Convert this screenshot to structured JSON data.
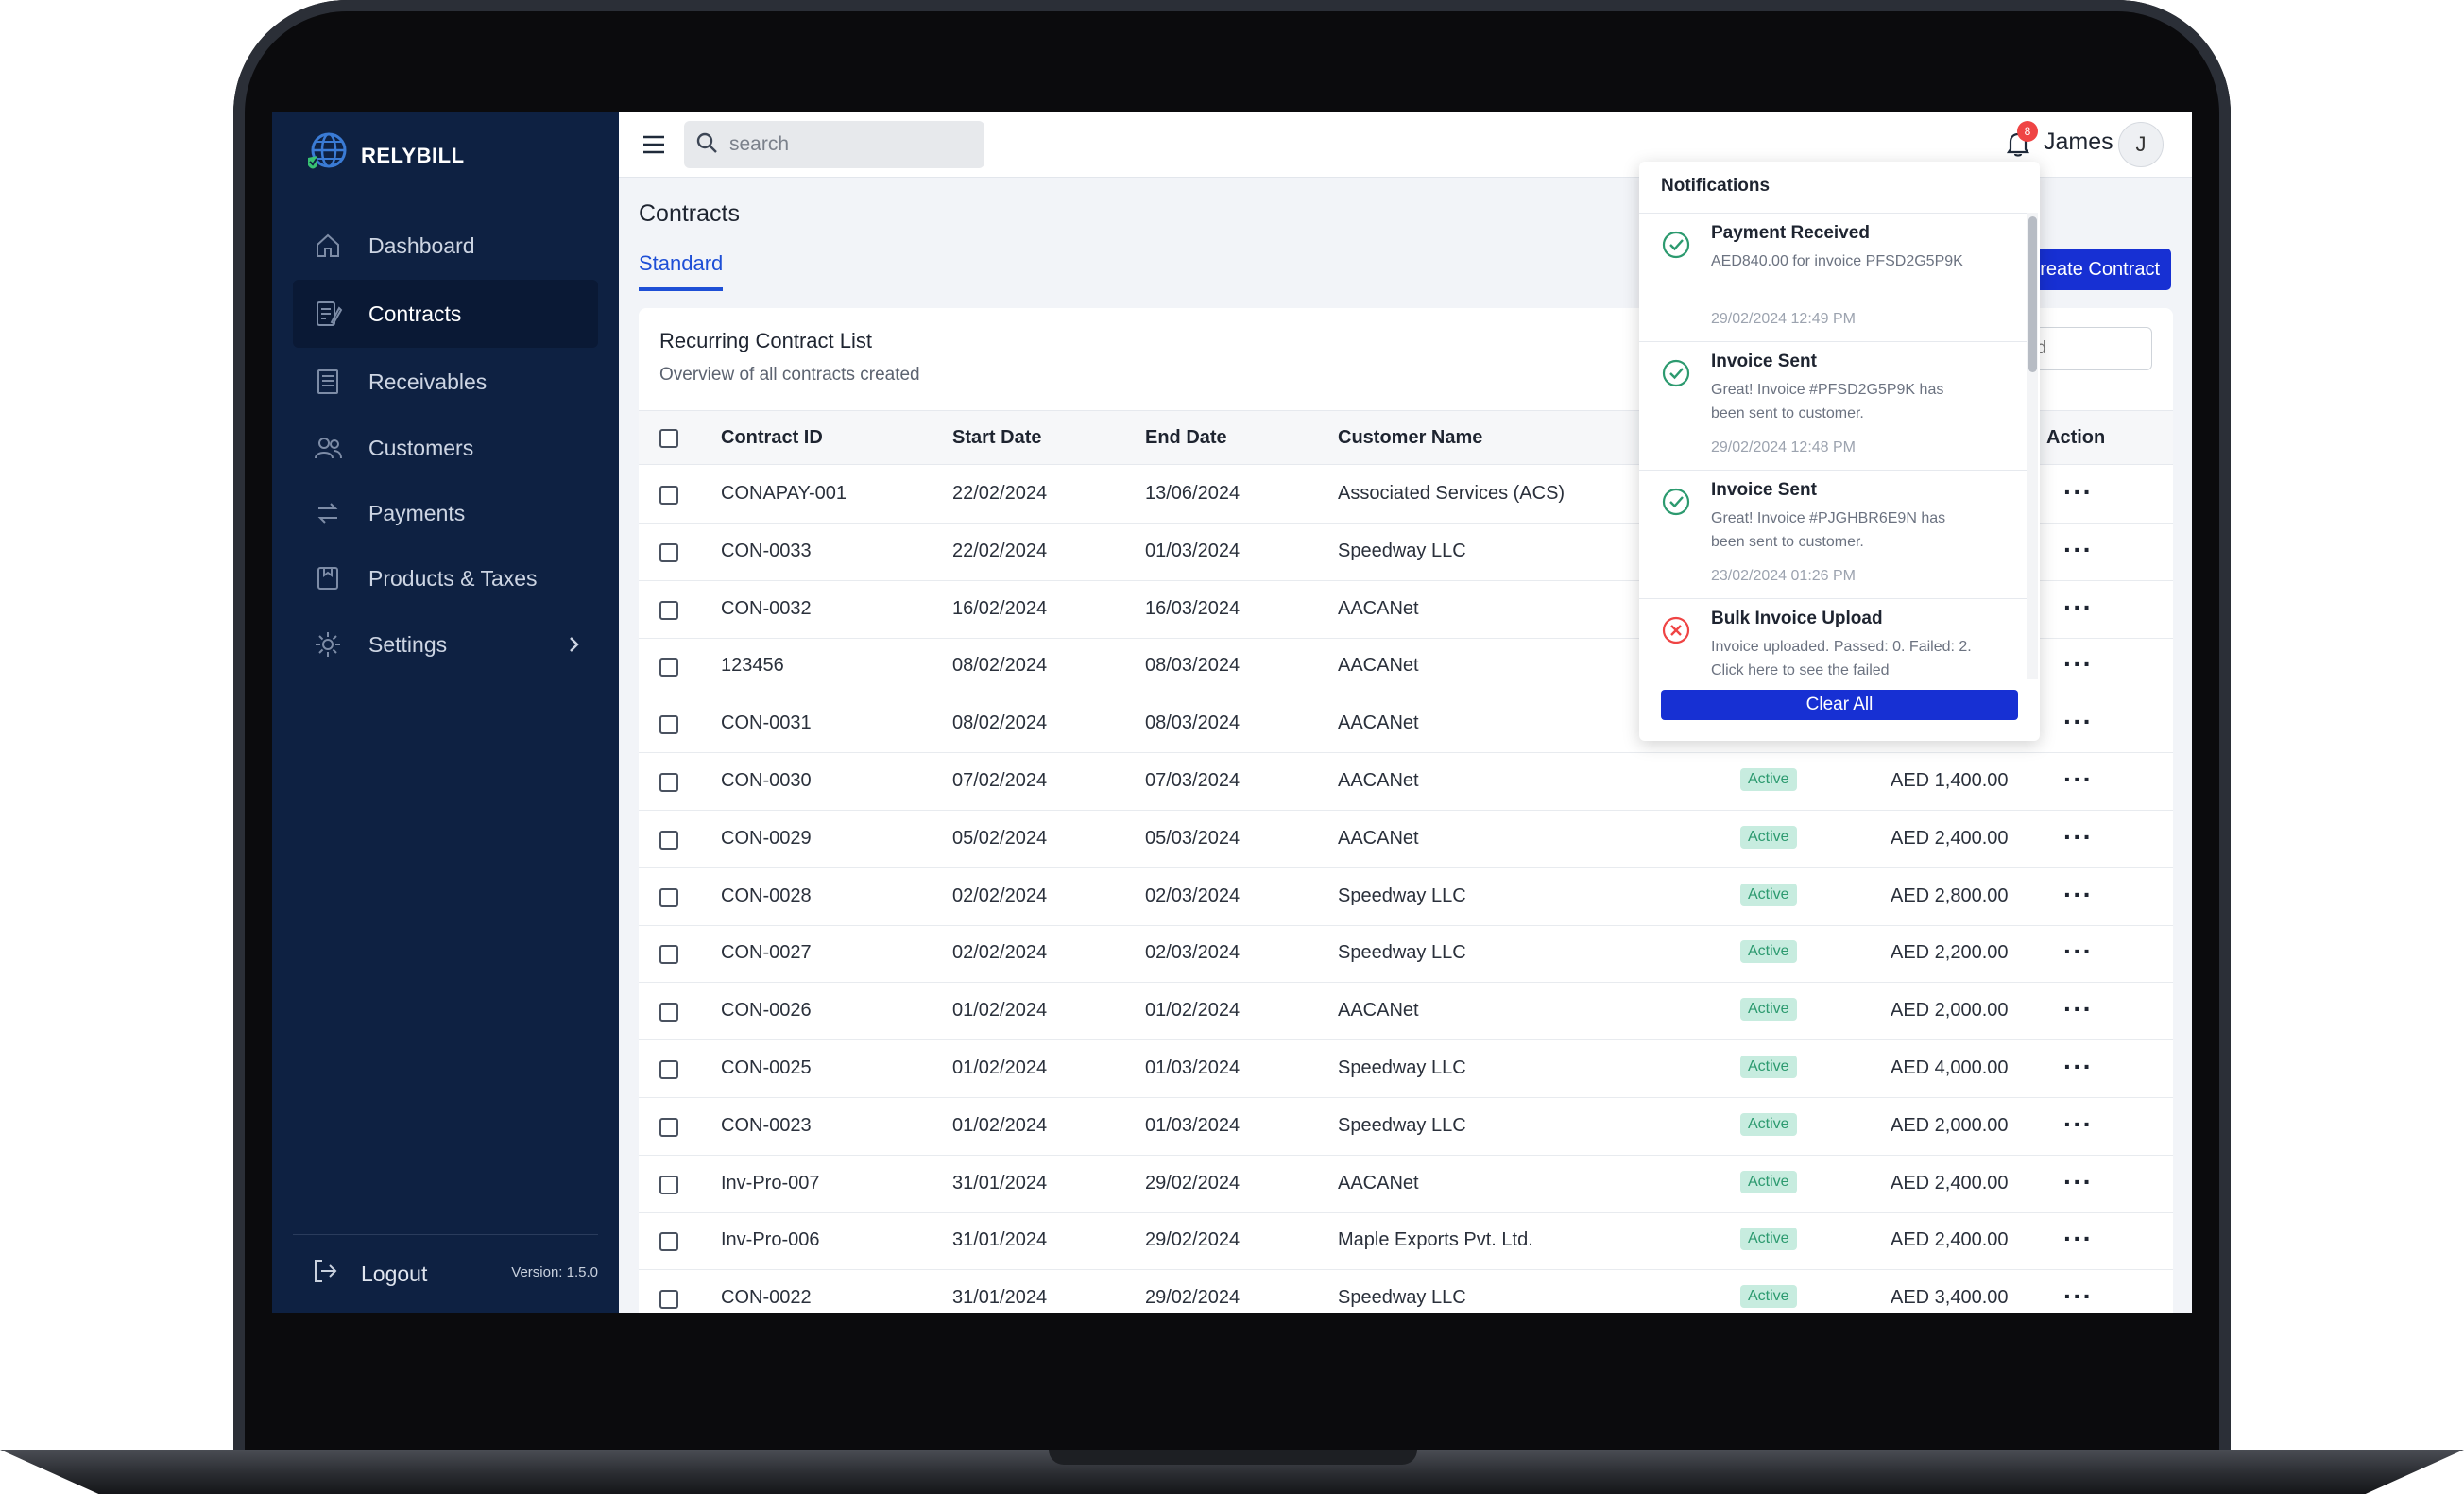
{
  "brand": {
    "name": "RELYBILL"
  },
  "sidebar": {
    "items": [
      {
        "label": "Dashboard",
        "icon": "home-icon"
      },
      {
        "label": "Contracts",
        "icon": "contract-icon"
      },
      {
        "label": "Receivables",
        "icon": "receivables-icon"
      },
      {
        "label": "Customers",
        "icon": "customers-icon"
      },
      {
        "label": "Payments",
        "icon": "payments-icon"
      },
      {
        "label": "Products & Taxes",
        "icon": "products-icon"
      },
      {
        "label": "Settings",
        "icon": "settings-icon"
      }
    ],
    "logout_label": "Logout",
    "version": "Version: 1.5.0"
  },
  "topbar": {
    "search_placeholder": "search",
    "notification_count": "8",
    "user_name": "James",
    "user_initial": "J"
  },
  "main": {
    "page_title": "Contracts",
    "tab_label": "Standard",
    "create_button_label": "Create Contract",
    "contract_search_placeholder": "tract id"
  },
  "table": {
    "title": "Recurring Contract List",
    "subtitle": "Overview of all contracts created",
    "headers": {
      "contract_id": "Contract ID",
      "start_date": "Start Date",
      "end_date": "End Date",
      "customer_name": "Customer Name",
      "action": "Action"
    },
    "rows": [
      {
        "id": "CONAPAY-001",
        "start": "22/02/2024",
        "end": "13/06/2024",
        "customer": "Associated Services (ACS)",
        "status": "",
        "amount": ""
      },
      {
        "id": "CON-0033",
        "start": "22/02/2024",
        "end": "01/03/2024",
        "customer": "Speedway LLC",
        "status": "",
        "amount": ""
      },
      {
        "id": "CON-0032",
        "start": "16/02/2024",
        "end": "16/03/2024",
        "customer": "AACANet",
        "status": "",
        "amount": ""
      },
      {
        "id": "123456",
        "start": "08/02/2024",
        "end": "08/03/2024",
        "customer": "AACANet",
        "status": "",
        "amount": ""
      },
      {
        "id": "CON-0031",
        "start": "08/02/2024",
        "end": "08/03/2024",
        "customer": "AACANet",
        "status": "",
        "amount": ""
      },
      {
        "id": "CON-0030",
        "start": "07/02/2024",
        "end": "07/03/2024",
        "customer": "AACANet",
        "status": "Active",
        "amount": "AED 1,400.00"
      },
      {
        "id": "CON-0029",
        "start": "05/02/2024",
        "end": "05/03/2024",
        "customer": "AACANet",
        "status": "Active",
        "amount": "AED 2,400.00"
      },
      {
        "id": "CON-0028",
        "start": "02/02/2024",
        "end": "02/03/2024",
        "customer": "Speedway LLC",
        "status": "Active",
        "amount": "AED 2,800.00"
      },
      {
        "id": "CON-0027",
        "start": "02/02/2024",
        "end": "02/03/2024",
        "customer": "Speedway LLC",
        "status": "Active",
        "amount": "AED 2,200.00"
      },
      {
        "id": "CON-0026",
        "start": "01/02/2024",
        "end": "01/02/2024",
        "customer": "AACANet",
        "status": "Active",
        "amount": "AED 2,000.00"
      },
      {
        "id": "CON-0025",
        "start": "01/02/2024",
        "end": "01/03/2024",
        "customer": "Speedway LLC",
        "status": "Active",
        "amount": "AED 4,000.00"
      },
      {
        "id": "CON-0023",
        "start": "01/02/2024",
        "end": "01/03/2024",
        "customer": "Speedway LLC",
        "status": "Active",
        "amount": "AED 2,000.00"
      },
      {
        "id": "Inv-Pro-007",
        "start": "31/01/2024",
        "end": "29/02/2024",
        "customer": "AACANet",
        "status": "Active",
        "amount": "AED 2,400.00"
      },
      {
        "id": "Inv-Pro-006",
        "start": "31/01/2024",
        "end": "29/02/2024",
        "customer": "Maple Exports Pvt. Ltd.",
        "status": "Active",
        "amount": "AED 2,400.00"
      },
      {
        "id": "CON-0022",
        "start": "31/01/2024",
        "end": "29/02/2024",
        "customer": "Speedway LLC",
        "status": "Active",
        "amount": "AED 3,400.00"
      }
    ]
  },
  "notifications": {
    "header": "Notifications",
    "clear_all_label": "Clear All",
    "items": [
      {
        "type": "success",
        "title": "Payment Received",
        "body": "AED840.00 for invoice PFSD2G5P9K",
        "time": "29/02/2024 12:49 PM"
      },
      {
        "type": "success",
        "title": "Invoice Sent",
        "body": "Great! Invoice #PFSD2G5P9K has been sent to customer.",
        "time": "29/02/2024 12:48 PM"
      },
      {
        "type": "success",
        "title": "Invoice Sent",
        "body": "Great! Invoice #PJGHBR6E9N has been sent to customer.",
        "time": "23/02/2024 01:26 PM"
      },
      {
        "type": "error",
        "title": "Bulk Invoice Upload",
        "body": "Invoice uploaded. Passed: 0. Failed: 2. Click here to see the failed",
        "time": ""
      }
    ]
  },
  "colors": {
    "sidebar": "#0e2142",
    "primary": "#1730d3",
    "success": "#2c9a6f",
    "error": "#ef4444"
  }
}
